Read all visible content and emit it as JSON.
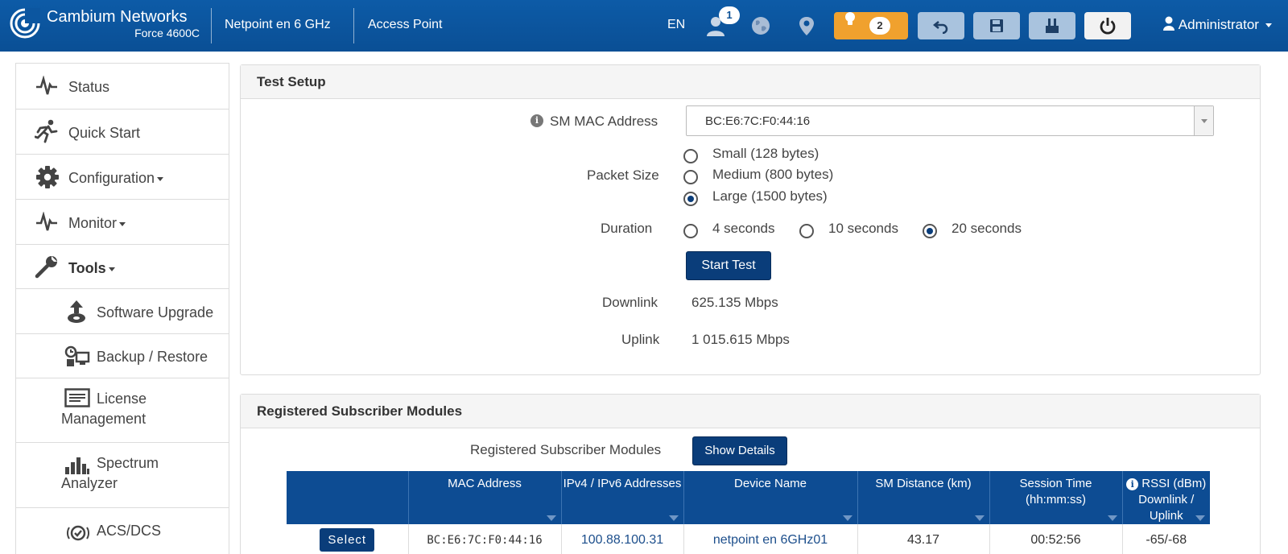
{
  "header": {
    "brand_name": "Cambium Networks",
    "brand_model": "Force 4600C",
    "device_name": "Netpoint en 6 GHz",
    "device_mode": "Access Point",
    "language": "EN",
    "users_badge": "1",
    "alerts_count": "2",
    "user_label": "Administrator",
    "icons": [
      "cambium-logo",
      "users-icon",
      "globe-icon",
      "map-pin-icon",
      "lightbulb-icon",
      "undo-icon",
      "save-icon",
      "reboot-config-icon",
      "power-icon",
      "user-icon"
    ],
    "colors": {
      "bar": "#0a4f95",
      "alert_button": "#f0a12e",
      "grey_button": "#a9c3de"
    }
  },
  "sidebar": {
    "items": [
      {
        "label": "Status",
        "icon": "pulse-icon"
      },
      {
        "label": "Quick Start",
        "icon": "running-person-icon"
      },
      {
        "label": "Configuration",
        "icon": "gear-icon"
      },
      {
        "label": "Monitor",
        "icon": "pulse-icon"
      },
      {
        "label": "Tools",
        "icon": "wrench-icon"
      }
    ],
    "tools_items": [
      {
        "label": "Software Upgrade",
        "icon": "upload-icon"
      },
      {
        "label": "Backup / Restore",
        "icon": "backup-icon"
      },
      {
        "label_line1": "License",
        "label_line2": "Management",
        "icon": "license-icon"
      },
      {
        "label_line1": "Spectrum",
        "label_line2": "Analyzer",
        "icon": "bar-chart-icon"
      },
      {
        "label": "ACS/DCS",
        "icon": "acs-icon"
      }
    ]
  },
  "test_setup": {
    "title": "Test Setup",
    "sm_mac_label": "SM MAC Address",
    "sm_mac_value": "BC:E6:7C:F0:44:16",
    "packet_size_label": "Packet Size",
    "packet_sizes": [
      "Small (128 bytes)",
      "Medium (800 bytes)",
      "Large (1500 bytes)"
    ],
    "packet_size_selected": "Large (1500 bytes)",
    "duration_label": "Duration",
    "durations": [
      "4 seconds",
      "10 seconds",
      "20 seconds"
    ],
    "duration_selected": "20 seconds",
    "start_button": "Start Test",
    "downlink_label": "Downlink",
    "downlink_value": "625.135 Mbps",
    "uplink_label": "Uplink",
    "uplink_value": "1 015.615 Mbps"
  },
  "registered_sm": {
    "title": "Registered Subscriber Modules",
    "row_label": "Registered Subscriber Modules",
    "show_details_button": "Show Details",
    "columns": {
      "mac": "MAC Address",
      "ip": "IPv4 / IPv6 Addresses",
      "device": "Device Name",
      "distance": "SM Distance (km)",
      "session_line1": "Session Time",
      "session_line2": "(hh:mm:ss)",
      "rssi_line1": "RSSI (dBm)",
      "rssi_line2": "Downlink / Uplink"
    },
    "rows": [
      {
        "select": "Select",
        "mac": "BC:E6:7C:F0:44:16",
        "ip": "100.88.100.31",
        "device": "netpoint en 6GHz01",
        "distance": "43.17",
        "session": "00:52:56",
        "rssi": "-65/-68"
      }
    ]
  }
}
